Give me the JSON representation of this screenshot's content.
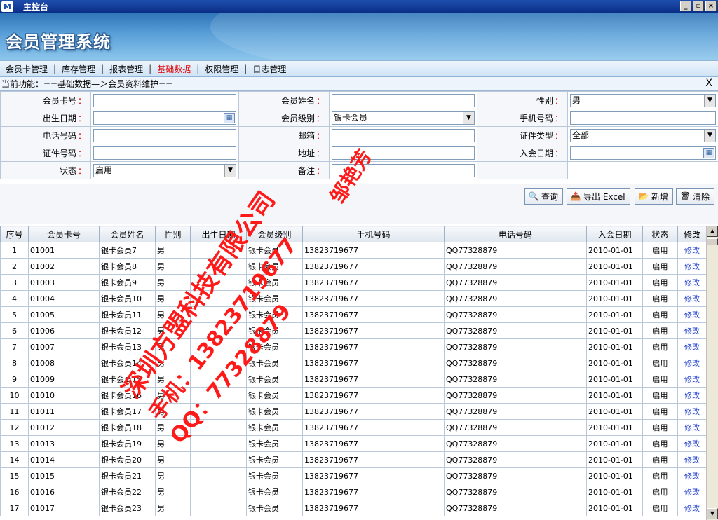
{
  "window": {
    "title": "主控台",
    "icon_letter": "M",
    "min": "_",
    "restore": "▫",
    "close": "×"
  },
  "banner": {
    "title": "会员管理系统"
  },
  "menu": [
    "会员卡管理",
    "库存管理",
    "报表管理",
    "基础数据",
    "权限管理",
    "日志管理"
  ],
  "menu_active_index": 3,
  "menu_sep": "|",
  "breadcrumb": "当前功能：==基础数据—＞会员资料维护==",
  "close_label": "X",
  "form": {
    "card_no": {
      "label": "会员卡号",
      "value": ""
    },
    "name": {
      "label": "会员姓名",
      "value": ""
    },
    "gender": {
      "label": "性别",
      "value": "男"
    },
    "birth": {
      "label": "出生日期",
      "value": ""
    },
    "level": {
      "label": "会员级别",
      "value": "银卡会员"
    },
    "mobile": {
      "label": "手机号码",
      "value": ""
    },
    "phone": {
      "label": "电话号码",
      "value": ""
    },
    "email": {
      "label": "邮箱",
      "value": ""
    },
    "id_type": {
      "label": "证件类型",
      "value": "全部"
    },
    "id_no": {
      "label": "证件号码",
      "value": ""
    },
    "address": {
      "label": "地址",
      "value": ""
    },
    "join_date": {
      "label": "入会日期",
      "value": ""
    },
    "status": {
      "label": "状态",
      "value": "启用"
    },
    "remark": {
      "label": "备注",
      "value": ""
    },
    "required_mark": "："
  },
  "buttons": {
    "query": "查询",
    "export": "导出 Excel",
    "add": "新增",
    "clear": "清除"
  },
  "grid": {
    "headers": [
      "序号",
      "会员卡号",
      "会员姓名",
      "性别",
      "出生日期",
      "会员级别",
      "手机号码",
      "电话号码",
      "入会日期",
      "状态",
      "修改"
    ],
    "rows": [
      [
        "1",
        "01001",
        "银卡会员7",
        "男",
        "",
        "银卡会员",
        "13823719677",
        "QQ77328879",
        "2010-01-01",
        "启用",
        "修改"
      ],
      [
        "2",
        "01002",
        "银卡会员8",
        "男",
        "",
        "银卡会员",
        "13823719677",
        "QQ77328879",
        "2010-01-01",
        "启用",
        "修改"
      ],
      [
        "3",
        "01003",
        "银卡会员9",
        "男",
        "",
        "银卡会员",
        "13823719677",
        "QQ77328879",
        "2010-01-01",
        "启用",
        "修改"
      ],
      [
        "4",
        "01004",
        "银卡会员10",
        "男",
        "",
        "银卡会员",
        "13823719677",
        "QQ77328879",
        "2010-01-01",
        "启用",
        "修改"
      ],
      [
        "5",
        "01005",
        "银卡会员11",
        "男",
        "",
        "银卡会员",
        "13823719677",
        "QQ77328879",
        "2010-01-01",
        "启用",
        "修改"
      ],
      [
        "6",
        "01006",
        "银卡会员12",
        "男",
        "",
        "银卡会员",
        "13823719677",
        "QQ77328879",
        "2010-01-01",
        "启用",
        "修改"
      ],
      [
        "7",
        "01007",
        "银卡会员13",
        "男",
        "",
        "银卡会员",
        "13823719677",
        "QQ77328879",
        "2010-01-01",
        "启用",
        "修改"
      ],
      [
        "8",
        "01008",
        "银卡会员14",
        "男",
        "",
        "银卡会员",
        "13823719677",
        "QQ77328879",
        "2010-01-01",
        "启用",
        "修改"
      ],
      [
        "9",
        "01009",
        "银卡会员15",
        "男",
        "",
        "银卡会员",
        "13823719677",
        "QQ77328879",
        "2010-01-01",
        "启用",
        "修改"
      ],
      [
        "10",
        "01010",
        "银卡会员16",
        "男",
        "",
        "银卡会员",
        "13823719677",
        "QQ77328879",
        "2010-01-01",
        "启用",
        "修改"
      ],
      [
        "11",
        "01011",
        "银卡会员17",
        "男",
        "",
        "银卡会员",
        "13823719677",
        "QQ77328879",
        "2010-01-01",
        "启用",
        "修改"
      ],
      [
        "12",
        "01012",
        "银卡会员18",
        "男",
        "",
        "银卡会员",
        "13823719677",
        "QQ77328879",
        "2010-01-01",
        "启用",
        "修改"
      ],
      [
        "13",
        "01013",
        "银卡会员19",
        "男",
        "",
        "银卡会员",
        "13823719677",
        "QQ77328879",
        "2010-01-01",
        "启用",
        "修改"
      ],
      [
        "14",
        "01014",
        "银卡会员20",
        "男",
        "",
        "银卡会员",
        "13823719677",
        "QQ77328879",
        "2010-01-01",
        "启用",
        "修改"
      ],
      [
        "15",
        "01015",
        "银卡会员21",
        "男",
        "",
        "银卡会员",
        "13823719677",
        "QQ77328879",
        "2010-01-01",
        "启用",
        "修改"
      ],
      [
        "16",
        "01016",
        "银卡会员22",
        "男",
        "",
        "银卡会员",
        "13823719677",
        "QQ77328879",
        "2010-01-01",
        "启用",
        "修改"
      ],
      [
        "17",
        "01017",
        "银卡会员23",
        "男",
        "",
        "银卡会员",
        "13823719677",
        "QQ77328879",
        "2010-01-01",
        "启用",
        "修改"
      ]
    ]
  },
  "watermarks": [
    "邹艳芳",
    "深圳方盟科技有限公司",
    "手机：13823719677",
    "QQ：77328879"
  ],
  "colors": {
    "watermark": "#ff1a1a",
    "active_menu": "#e00000",
    "link": "#1f3fcf"
  }
}
